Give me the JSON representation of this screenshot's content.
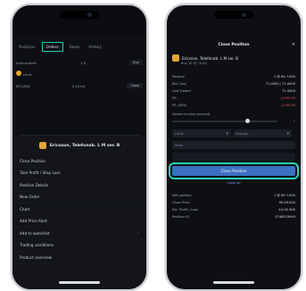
{
  "left": {
    "tabs": [
      "Positions",
      "Orders",
      "Deals",
      "History"
    ],
    "active_tab_index": 1,
    "rows": [
      {
        "label": "Instruments",
        "value": "1.0",
        "extra": "Buy"
      },
      {
        "label": "Limit",
        "value": "",
        "extra": ""
      },
      {
        "label": "BTCUSD",
        "value": "0.10 lot",
        "extra": "Close"
      }
    ],
    "sheet": {
      "title": "Ericsson, Telefonab. L M ser. B",
      "items": [
        "Close Position",
        "Take Profit / Stop Loss",
        "Position Details",
        "New Order",
        "Chart",
        "Add Price Alert",
        "Add to watchlist",
        "Trading conditions",
        "Product overview"
      ]
    }
  },
  "right": {
    "header": "Close Position",
    "close_glyph": "×",
    "symbol": "Ericsson, Telefonab. L M ser. B",
    "symbol_sub": "Buy 10 @ 70.40",
    "stats": [
      {
        "k": "Position",
        "v": "1 @ 69.7.000",
        "neg": false
      },
      {
        "k": "Bid / Ask",
        "v": "71.0000 / 71.0000",
        "neg": false
      },
      {
        "k": "Last Traded",
        "v": "71.0000",
        "neg": false
      },
      {
        "k": "P/L",
        "v": "-1,000.00",
        "neg": true
      },
      {
        "k": "P/L (SEK)",
        "v": "-1,000.00",
        "neg": true
      }
    ],
    "volume_label": "Volume to close (percent)",
    "volume_value": "1",
    "volume_fraction": 0.72,
    "order_type": "Limit",
    "duration": "Session",
    "price_placeholder": "Price",
    "close_button": "Close Position",
    "close_all_link": "Close all",
    "summary": [
      {
        "k": "Net position",
        "v": "1 @ 69.7.000"
      },
      {
        "k": "Close Price",
        "v": "69.40.000"
      },
      {
        "k": "Est. Profit / Loss",
        "v": "-10.00 SEK"
      },
      {
        "k": "Position ID",
        "v": "3748533949"
      }
    ]
  }
}
